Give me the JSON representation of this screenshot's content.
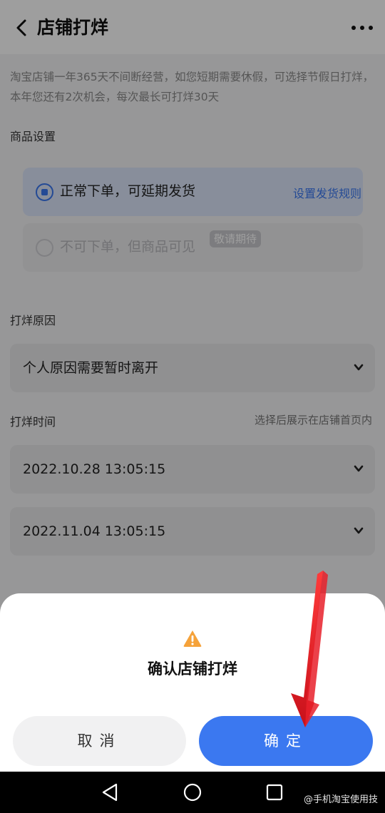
{
  "header": {
    "title": "店铺打烊"
  },
  "notice": "淘宝店铺一年365天不间断经营，如您短期需要休假，可选择节假日打烊，本年您还有2次机会，每次最长可打烊30天",
  "goods_settings": {
    "label": "商品设置",
    "options": [
      {
        "label": "正常下单，可延期发货",
        "link": "设置发货规则",
        "selected": true
      },
      {
        "label": "不可下单，但商品可见",
        "badge": "敬请期待",
        "selected": false
      }
    ]
  },
  "reason": {
    "label": "打烊原因",
    "value": "个人原因需要暂时离开"
  },
  "time": {
    "label": "打烊时间",
    "hint": "选择后展示在店铺首页内",
    "start": "2022.10.28 13:05:15",
    "end": "2022.11.04 13:05:15"
  },
  "dialog": {
    "title": "确认店铺打烊",
    "cancel_label": "取消",
    "confirm_label": "确定"
  },
  "watermark": "@手机淘宝使用技",
  "colors": {
    "accent": "#3b78f0",
    "warning": "#f5a23a",
    "arrow": "#e8202a"
  }
}
